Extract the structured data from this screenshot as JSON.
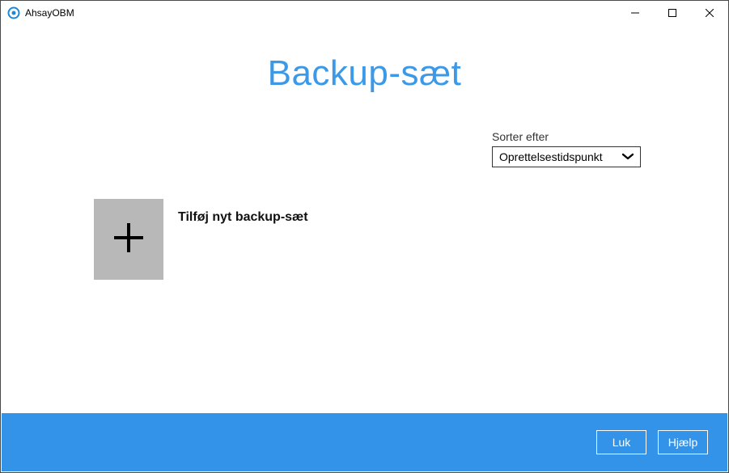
{
  "window": {
    "title": "AhsayOBM"
  },
  "page": {
    "title": "Backup-sæt"
  },
  "sort": {
    "label": "Sorter efter",
    "selected": "Oprettelsestidspunkt"
  },
  "add": {
    "label": "Tilføj nyt backup-sæt"
  },
  "footer": {
    "close": "Luk",
    "help": "Hjælp"
  }
}
